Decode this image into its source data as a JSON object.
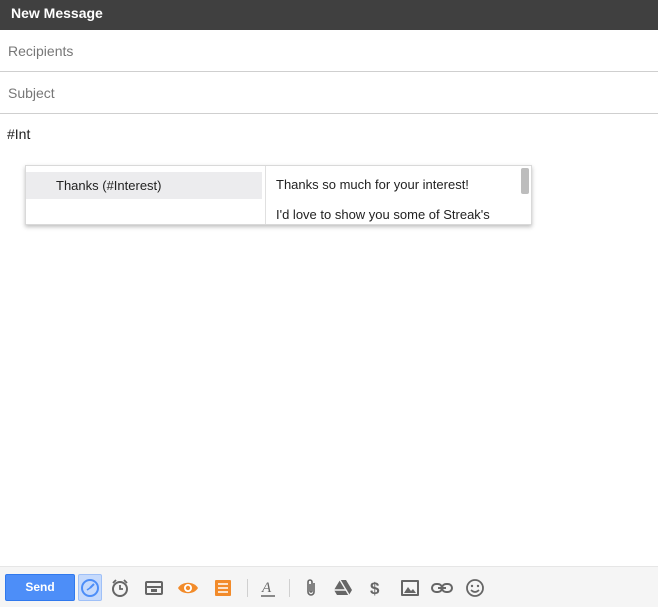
{
  "window": {
    "title": "New Message"
  },
  "fields": {
    "recipients_placeholder": "Recipients",
    "subject_placeholder": "Subject"
  },
  "body": {
    "text": "#Int"
  },
  "snippet_popup": {
    "items": [
      {
        "label": "Thanks (#Interest)"
      }
    ],
    "preview_lines": [
      "Thanks so much for your interest!",
      "I'd love to show you some of Streak's"
    ]
  },
  "toolbar": {
    "send_label": "Send",
    "icons": [
      "schedule-send-icon",
      "reminder-alarm-icon",
      "snippets-icon",
      "tracking-eye-icon",
      "notes-icon",
      "formatting-icon",
      "attach-icon",
      "drive-icon",
      "money-icon",
      "insert-photo-icon",
      "insert-link-icon",
      "emoji-icon"
    ],
    "accent_color": "#4d8ef8",
    "streak_orange": "#f28b2a"
  }
}
